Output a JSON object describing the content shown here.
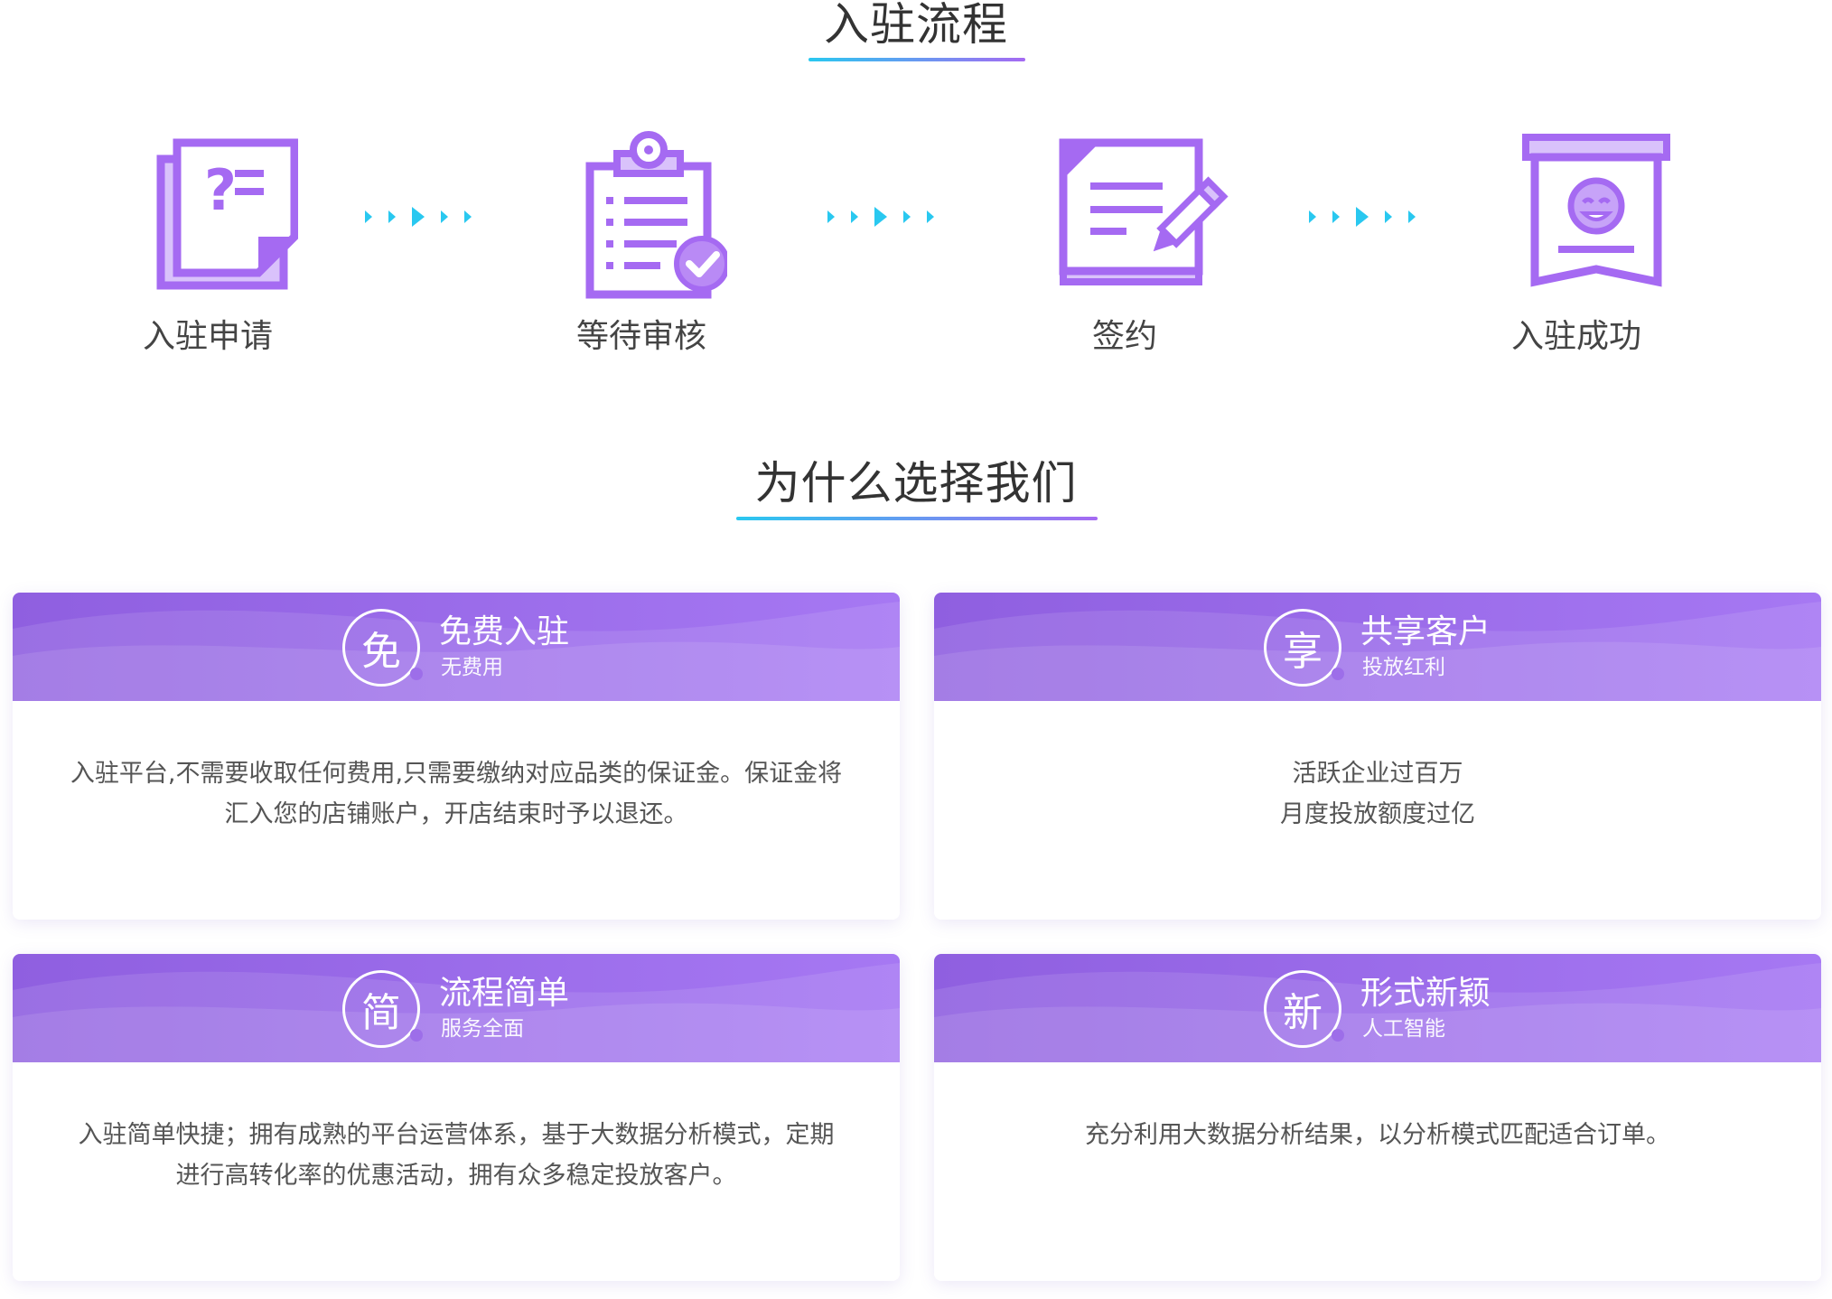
{
  "process": {
    "title": "入驻流程",
    "steps": [
      {
        "label": "入驻申请",
        "icon": "application-form-icon"
      },
      {
        "label": "等待审核",
        "icon": "clipboard-review-icon"
      },
      {
        "label": "签约",
        "icon": "sign-contract-icon"
      },
      {
        "label": "入驻成功",
        "icon": "success-badge-icon"
      }
    ]
  },
  "why": {
    "title": "为什么选择我们",
    "cards": [
      {
        "badge": "免",
        "title": "免费入驻",
        "subtitle": "无费用",
        "body": "入驻平台,不需要收取任何费用,只需要缴纳对应品类的保证金。保证金将汇入您的店铺账户，开店结束时予以退还。"
      },
      {
        "badge": "享",
        "title": "共享客户",
        "subtitle": "投放红利",
        "body_lines": [
          "活跃企业过百万",
          "月度投放额度过亿"
        ]
      },
      {
        "badge": "简",
        "title": "流程简单",
        "subtitle": "服务全面",
        "body": "入驻简单快捷；拥有成熟的平台运营体系，基于大数据分析模式，定期进行高转化率的优惠活动，拥有众多稳定投放客户。"
      },
      {
        "badge": "新",
        "title": "形式新颖",
        "subtitle": "人工智能",
        "body": "充分利用大数据分析结果，以分析模式匹配适合订单。"
      }
    ]
  },
  "colors": {
    "accent_purple": "#a56af2",
    "accent_cyan": "#29c8f0",
    "text_dark": "#333333"
  }
}
